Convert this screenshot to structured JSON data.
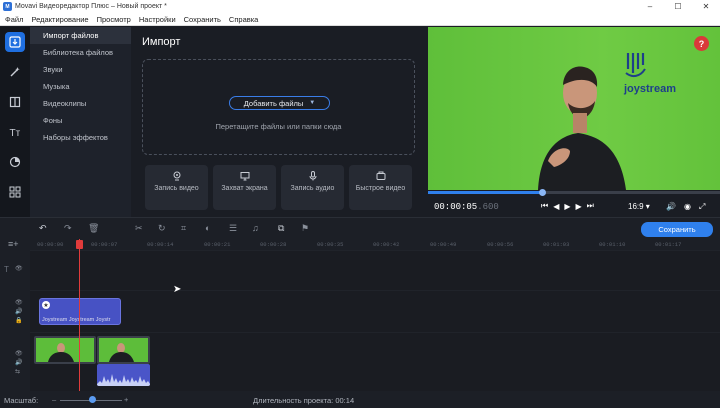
{
  "window": {
    "title": "Movavi Видеоредактор Плюс – Новый проект *",
    "app_icon": "movavi-icon"
  },
  "menu": [
    "Файл",
    "Редактирование",
    "Просмотр",
    "Настройки",
    "Сохранить",
    "Справка"
  ],
  "sidebar_icons": [
    "import-icon",
    "magic-wand-icon",
    "transitions-icon",
    "titles-icon",
    "filters-icon",
    "more-tools-icon"
  ],
  "categories": [
    "Импорт файлов",
    "Библиотека файлов",
    "Звуки",
    "Музыка",
    "Видеоклипы",
    "Фоны",
    "Наборы эффектов"
  ],
  "import": {
    "heading": "Импорт",
    "add_files": "Добавить файлы",
    "drag_hint": "Перетащите файлы или папки сюда",
    "tiles": [
      {
        "label": "Запись видео",
        "icon": "webcam-icon"
      },
      {
        "label": "Захват экрана",
        "icon": "monitor-icon"
      },
      {
        "label": "Запись аудио",
        "icon": "microphone-icon"
      },
      {
        "label": "Быстрое видео",
        "icon": "quick-video-icon"
      }
    ]
  },
  "player": {
    "timecode_main": "00:00:05",
    "timecode_ms": ".600",
    "progress": 0.39,
    "aspect": "16:9",
    "logo_text": "joystream",
    "help": "?"
  },
  "toolbar": {
    "save_label": "Сохранить"
  },
  "ruler_ticks": [
    "00:00:00",
    "00:00:07",
    "00:00:14",
    "00:00:21",
    "00:00:28",
    "00:00:35",
    "00:00:42",
    "00:00:49",
    "00:00:56",
    "00:01:03",
    "00:01:10",
    "00:01:17"
  ],
  "timeline": {
    "title_clip_text": "Joystream  Joystream  Joystr"
  },
  "status": {
    "zoom_label": "Масштаб:",
    "duration_label": "Длительность проекта:",
    "duration_value": "00:14"
  },
  "colors": {
    "accent": "#2f80ed",
    "playhead": "#e03b3b",
    "title_clip": "#4752c4",
    "green_screen": "#62c23c"
  }
}
